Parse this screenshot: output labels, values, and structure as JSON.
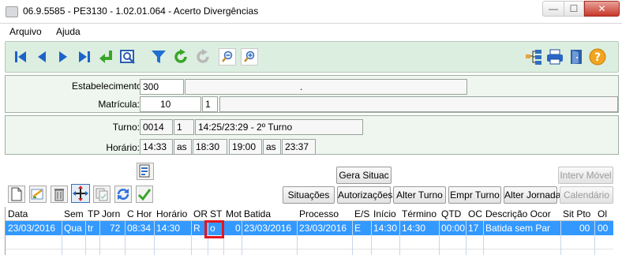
{
  "window": {
    "title": "06.9.5585 - PE3130 - 1.02.01.064 - Acerto Divergências",
    "minimize_glyph": "—",
    "maximize_glyph": "☐",
    "close_glyph": "✕"
  },
  "menu": {
    "items": [
      "Arquivo",
      "Ajuda"
    ]
  },
  "toolbar": {
    "icons": [
      "first-record-icon",
      "previous-record-icon",
      "next-record-icon",
      "last-record-icon",
      "go-to-icon",
      "search-icon",
      "filter-icon",
      "refresh-icon",
      "redo-icon",
      "zoom-out-icon",
      "zoom-in-icon",
      "tree-icon",
      "print-icon",
      "exit-icon",
      "help-icon"
    ],
    "help_glyph": "?"
  },
  "establishment": {
    "estabelecimento_label": "Estabelecimento:",
    "estabelecimento_code": "300",
    "estabelecimento_name": ".",
    "matricula_label": "Matrícula:",
    "matricula_value": "10",
    "matricula_digit": "1",
    "matricula_name": ""
  },
  "schedule": {
    "turno_label": "Turno:",
    "turno_code": "0014",
    "turno_seq": "1",
    "turno_desc": "14:25/23:29 - 2º Turno",
    "horario_label": "Horário:",
    "horario_1": "14:33",
    "as_1": "as",
    "horario_2": "18:30",
    "horario_3": "19:00",
    "as_2": "as",
    "horario_4": "23:37"
  },
  "actions": {
    "gera_situac": "Gera Situac",
    "interv_movel": "Interv Móvel",
    "situacoes": "Situações",
    "autorizacoes": "Autorizações",
    "alter_turno": "Alter Turno",
    "empr_turno": "Empr Turno",
    "alter_jornada": "Alter Jornada",
    "calendario": "Calendário"
  },
  "grid": {
    "columns": [
      "Data",
      "Sem",
      "TP",
      "Jorn",
      "C Hor",
      "Horário",
      "OR",
      "ST",
      "Mot",
      "Batida",
      "Processo",
      "E/S",
      "Início",
      "Término",
      "QTD",
      "OC",
      "Descrição Ocor",
      "Sit Pto",
      "Ol"
    ],
    "row": {
      "data": "23/03/2016",
      "sem": "Qua",
      "tp": "tr",
      "jorn": "72",
      "chor": "08:34",
      "horario": "14:30",
      "or": "R",
      "st": "o",
      "mot": "0",
      "batida": "23/03/2016",
      "processo": "23/03/2016",
      "es": "E",
      "inicio": "14:30",
      "termino": "14:30",
      "qtd": "00:00",
      "oc": "17",
      "descricao": "Batida sem Par",
      "sitpto": "00",
      "ol": "00"
    }
  }
}
